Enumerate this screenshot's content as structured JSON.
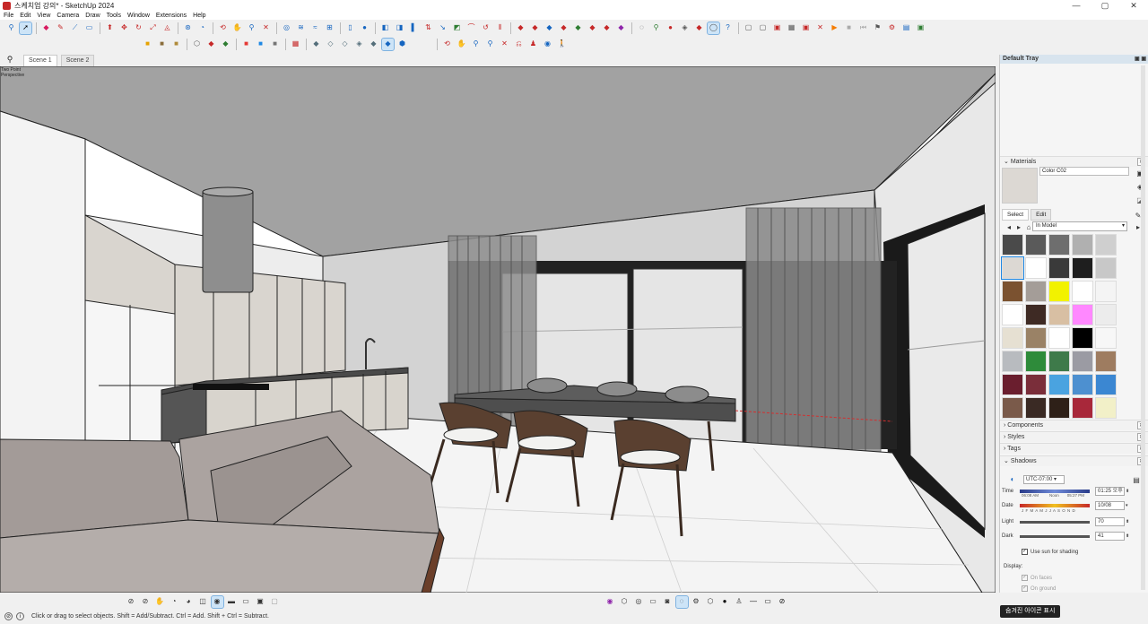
{
  "window": {
    "title": "스케치업 강의* - SketchUp 2024",
    "minimize": "—",
    "maximize": "▢",
    "close": "✕"
  },
  "menu": [
    "File",
    "Edit",
    "View",
    "Camera",
    "Draw",
    "Tools",
    "Window",
    "Extensions",
    "Help"
  ],
  "scenes": {
    "tabs": [
      "Scene 1",
      "Scene 2"
    ],
    "active": "Scene 1"
  },
  "viewport": {
    "camera_label": "Two Point Perspective"
  },
  "tray": {
    "title": "Default Tray",
    "materials": {
      "heading": "Materials",
      "current_name": "Color C02",
      "tab_select": "Select",
      "tab_edit": "Edit",
      "library": "In Model",
      "swatch_colors": [
        "#4a4a4a",
        "#5a5a5a",
        "#6e6e6e",
        "#b0b0b0",
        "#cfcfcf",
        "#dcd8d3",
        "#ffffff",
        "#3a3a3a",
        "#1e1e1e",
        "#c8c8c8",
        "#7b5230",
        "#a49d98",
        "#f2f200",
        "#ffffff",
        "#f4f4f4",
        "#ffffff",
        "#3e2a24",
        "#d8bfa3",
        "#ff88ff",
        "#ececec",
        "#e6e0d2",
        "#9a8266",
        "#ffffff",
        "#000000",
        "#f7f7f7",
        "#b8bbbf",
        "#2e8b3a",
        "#3e7a4a",
        "#9b9ba3",
        "#9e7c60",
        "#6a1e2e",
        "#7a2e3a",
        "#4aa3e0",
        "#4d90d0",
        "#3b87d2",
        "#7a5a4a",
        "#3a2a24",
        "#2e2018",
        "#a8283a",
        "#f2f0c8"
      ]
    },
    "sections": [
      "Components",
      "Styles",
      "Tags"
    ],
    "shadows": {
      "heading": "Shadows",
      "timezone": "UTC-07:00",
      "time_label": "Time",
      "time_start": "06:08 AM",
      "time_noon": "Noon",
      "time_end": "05:27 PM",
      "time_value": "01:25 오후",
      "date_label": "Date",
      "months": "J F M A M J J A S O N D",
      "date_value": "10/08",
      "light_label": "Light",
      "light_value": "70",
      "dark_label": "Dark",
      "dark_value": "41",
      "use_sun": "Use sun for shading",
      "display_label": "Display:",
      "on_faces": "On faces",
      "on_ground": "On ground"
    }
  },
  "status": {
    "message": "Click or drag to select objects. Shift = Add/Subtract. Ctrl = Add. Shift + Ctrl = Subtract.",
    "tooltip": "숨겨진 아이콘 표시"
  }
}
